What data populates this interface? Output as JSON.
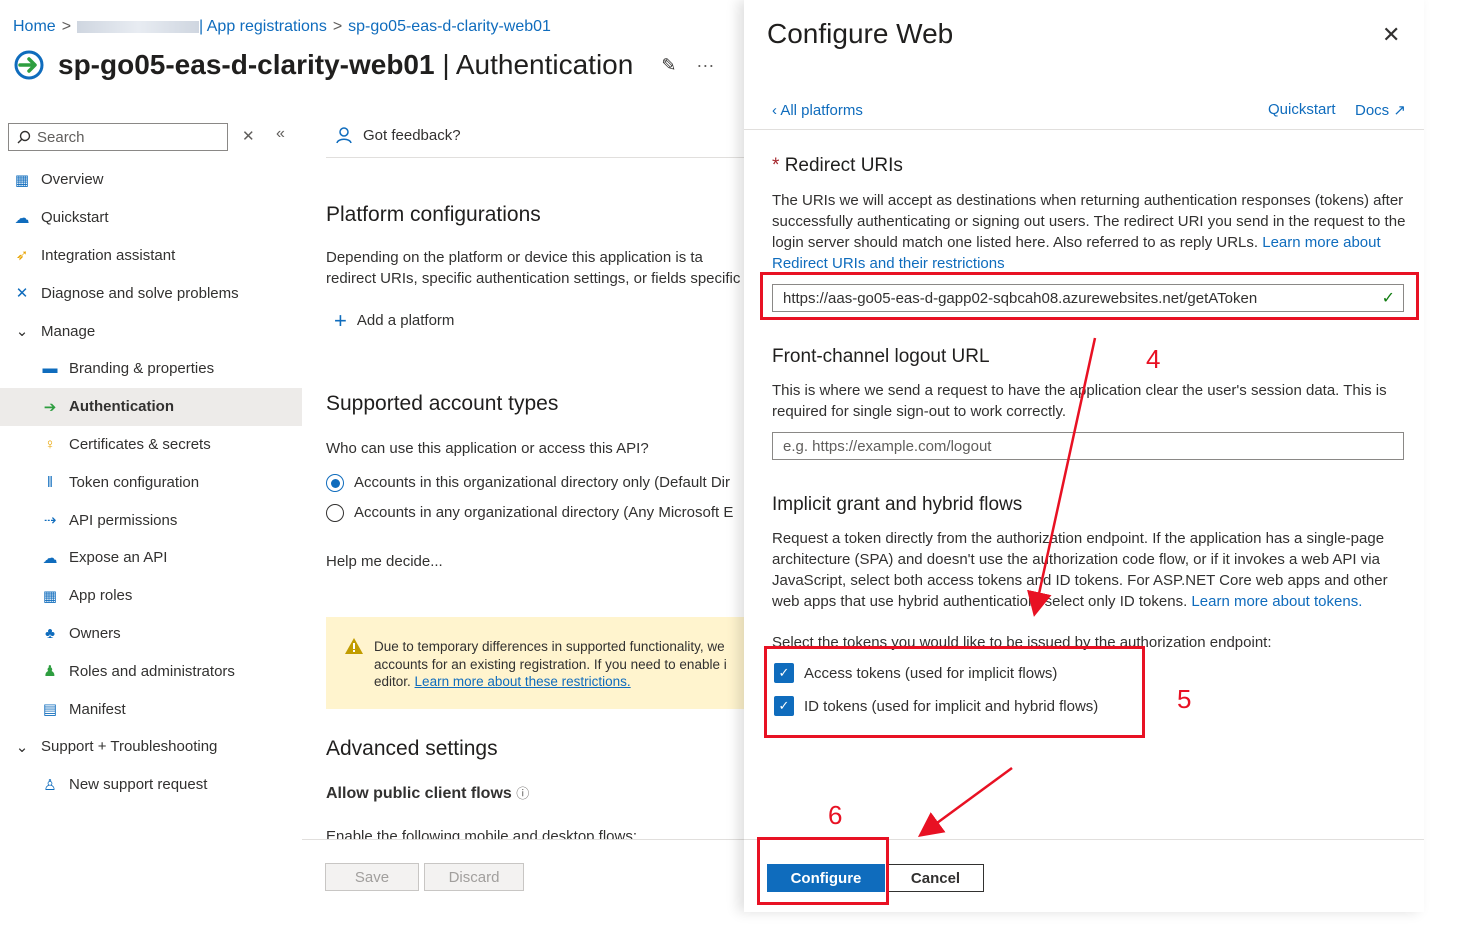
{
  "breadcrumb": {
    "home": "Home",
    "app_registrations": "| App registrations",
    "app": "sp-go05-eas-d-clarity-web01"
  },
  "header": {
    "title_bold": "sp-go05-eas-d-clarity-web01",
    "title_rest": " | Authentication"
  },
  "sidebar": {
    "search_placeholder": "Search",
    "items": [
      {
        "label": "Overview",
        "icon": "grid-icon",
        "level": 0
      },
      {
        "label": "Quickstart",
        "icon": "cloud-icon",
        "level": 0
      },
      {
        "label": "Integration assistant",
        "icon": "rocket-icon",
        "level": 0
      },
      {
        "label": "Diagnose and solve problems",
        "icon": "tools-icon",
        "level": 0
      },
      {
        "label": "Manage",
        "icon": "chevron-down-icon",
        "level": 0
      },
      {
        "label": "Branding & properties",
        "icon": "branding-icon",
        "level": 1
      },
      {
        "label": "Authentication",
        "icon": "authentication-icon",
        "level": 1,
        "active": true
      },
      {
        "label": "Certificates & secrets",
        "icon": "key-icon",
        "level": 1
      },
      {
        "label": "Token configuration",
        "icon": "token-icon",
        "level": 1
      },
      {
        "label": "API permissions",
        "icon": "api-icon",
        "level": 1
      },
      {
        "label": "Expose an API",
        "icon": "cloud-icon",
        "level": 1
      },
      {
        "label": "App roles",
        "icon": "grid-icon",
        "level": 1
      },
      {
        "label": "Owners",
        "icon": "owners-icon",
        "level": 1
      },
      {
        "label": "Roles and administrators",
        "icon": "roles-icon",
        "level": 1
      },
      {
        "label": "Manifest",
        "icon": "manifest-icon",
        "level": 1
      },
      {
        "label": "Support + Troubleshooting",
        "icon": "chevron-down-icon",
        "level": 0
      },
      {
        "label": "New support request",
        "icon": "support-icon",
        "level": 1
      }
    ]
  },
  "main": {
    "feedback": "Got feedback?",
    "platform_heading": "Platform configurations",
    "platform_desc_1": "Depending on the platform or device this application is ta",
    "platform_desc_2": "redirect URIs, specific authentication settings, or fields specific",
    "add_platform": "Add a platform",
    "account_heading": "Supported account types",
    "account_question": "Who can use this application or access this API?",
    "account_option_1": "Accounts in this organizational directory only (Default Dir",
    "account_option_2": "Accounts in any organizational directory (Any Microsoft E",
    "help_link": "Help me decide...",
    "warning_line_1": "Due to temporary differences in supported functionality, we",
    "warning_line_2": "accounts for an existing registration. If you need to enable i",
    "warning_line_3_prefix": "editor.",
    "warning_link": "Learn more about these restrictions.",
    "advanced_heading": "Advanced settings",
    "public_flows": "Allow public client flows",
    "enable_flows": "Enable the following mobile and desktop flows:",
    "save": "Save",
    "discard": "Discard"
  },
  "panel": {
    "title": "Configure Web",
    "back": "All platforms",
    "quickstart": "Quickstart",
    "docs": "Docs",
    "redirect_required": "*",
    "redirect_heading": "Redirect URIs",
    "redirect_desc": "The URIs we will accept as destinations when returning authentication responses (tokens) after successfully authenticating or signing out users. The redirect URI you send in the request to the login server should match one listed here. Also referred to as reply URLs.",
    "redirect_link": "Learn more about Redirect URIs and their restrictions",
    "redirect_value": "https://aas-go05-eas-d-gapp02-sqbcah08.azurewebsites.net/getAToken",
    "logout_heading": "Front-channel logout URL",
    "logout_desc": "This is where we send a request to have the application clear the user's session data. This is required for single sign-out to work correctly.",
    "logout_placeholder": "e.g. https://example.com/logout",
    "implicit_heading": "Implicit grant and hybrid flows",
    "implicit_desc": "Request a token directly from the authorization endpoint. If the application has a single-page architecture (SPA) and doesn't use the authorization code flow, or if it invokes a web API via JavaScript, select both access tokens and ID tokens. For ASP.NET Core web apps and other web apps that use hybrid authentication, select only ID tokens.",
    "implicit_link": "Learn more about tokens.",
    "tokens_prompt": "Select the tokens you would like to be issued by the authorization endpoint:",
    "access_tokens": "Access tokens (used for implicit flows)",
    "access_checked": true,
    "id_tokens": "ID tokens (used for implicit and hybrid flows)",
    "id_checked": true,
    "configure": "Configure",
    "cancel": "Cancel"
  },
  "annotations": {
    "step4": "4",
    "step5": "5",
    "step6": "6",
    "color": "#e81123"
  }
}
